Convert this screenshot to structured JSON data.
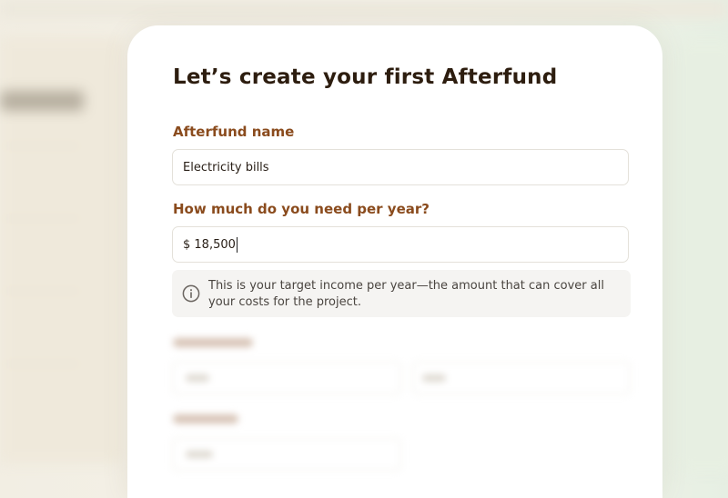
{
  "dialog": {
    "title": "Let’s create your first Afterfund",
    "name_label": "Afterfund name",
    "name_value": "Electricity bills",
    "amount_label": "How much do you need per year?",
    "amount_value": "$ 18,500",
    "info_text": "This is your target income per year—the amount that can cover all your costs for the project."
  },
  "icons": {
    "info": "info-circle-icon"
  },
  "colors": {
    "title": "#2d1d0f",
    "label": "#8a4b1d",
    "info_background": "#f5f4f2"
  }
}
